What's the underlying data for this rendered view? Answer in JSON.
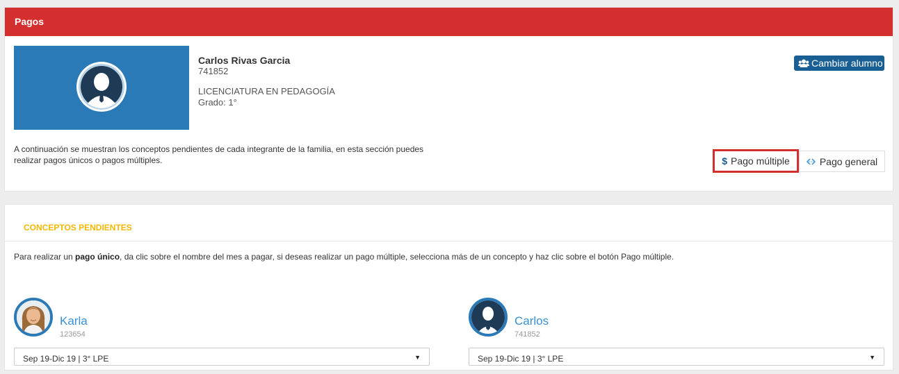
{
  "header": {
    "title": "Pagos"
  },
  "student": {
    "name": "Carlos Rivas Garcia",
    "id": "741852",
    "career": "LICENCIATURA EN PEDAGOGÍA",
    "grade": "Grado: 1°"
  },
  "actions": {
    "change_student_label": "Cambiar alumno",
    "multiple_payment_label": "Pago múltiple",
    "general_payment_label": "Pago general"
  },
  "description": "A continuación se muestran los conceptos pendientes de cada integrante de la familia, en esta sección puedes realizar pagos únicos o pagos múltiples.",
  "pending": {
    "title": "CONCEPTOS PENDIENTES",
    "instructions_prefix": "Para realizar un ",
    "instructions_bold": "pago único",
    "instructions_suffix": ", da clic sobre el nombre del mes a pagar, si deseas realizar un pago múltiple, selecciona más de un concepto y haz clic sobre el botón Pago múltiple."
  },
  "members": [
    {
      "name": "Karla",
      "id": "123654",
      "period": "Sep 19-Dic 19 | 3° LPE"
    },
    {
      "name": "Carlos",
      "id": "741852",
      "period": "Sep 19-Dic 19 | 3° LPE"
    }
  ],
  "colors": {
    "header": "#d32f2f",
    "primary": "#1a5f94",
    "photo_bg": "#2b7ab8",
    "section_title": "#f5b800",
    "link": "#3a8fd0"
  },
  "icons": [
    "user-silhouette-icon",
    "users-group-icon",
    "dollar-icon",
    "exchange-icon",
    "caret-down-icon"
  ]
}
